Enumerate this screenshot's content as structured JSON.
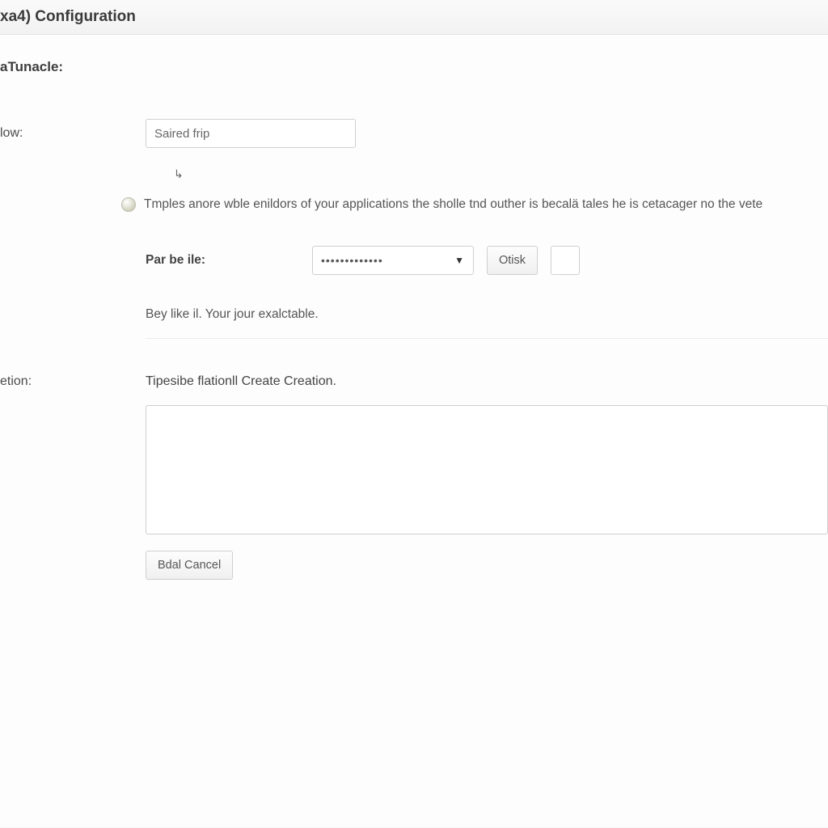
{
  "header": {
    "title": "xa4) Configuration"
  },
  "form": {
    "section_label": "aTunacle:",
    "row1": {
      "label": "low:",
      "input_value": "Saired frip"
    },
    "cursor_glyph": "↳",
    "info_text": "Tmples anore wble enildors of your applications  the sholle tnd outher is becalä tales he is cetacager no the vete",
    "par_be": {
      "label": "Par be ile:",
      "dropdown_value": "•••••••••••••",
      "button_label": "Otisk"
    },
    "sub_text": "Bey like il. Your jour exalctable.",
    "row2": {
      "label": "etion:",
      "heading": "Tipesibe flationll Create Creation.",
      "textarea_value": ""
    },
    "cancel_button": "Bdal Cancel"
  }
}
